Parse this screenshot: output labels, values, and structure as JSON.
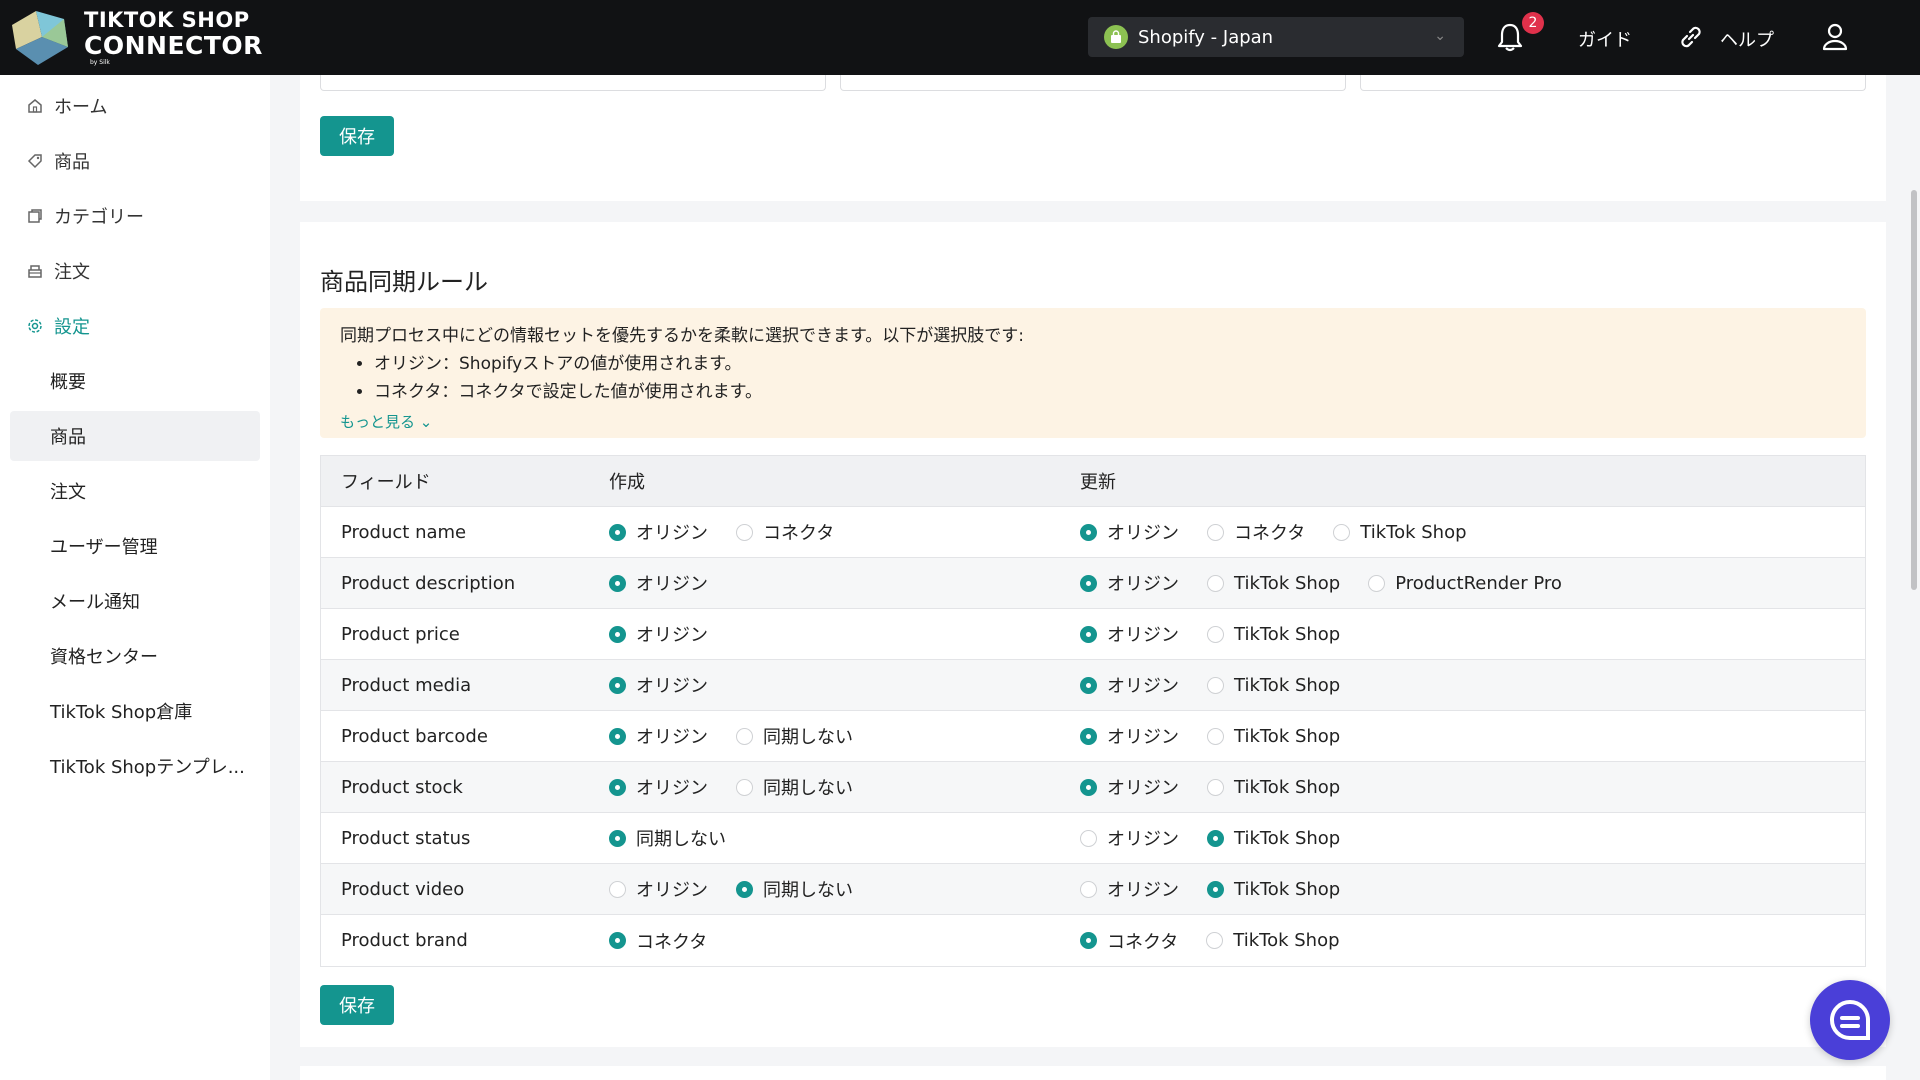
{
  "header": {
    "logo_line1": "TIKTOK SHOP",
    "logo_line2": "CONNECTOR",
    "logo_line3": "by Silk",
    "store_name": "Shopify - Japan",
    "notification_count": "2",
    "guide_label": "ガイド",
    "help_label": "ヘルプ"
  },
  "sidebar": {
    "items": [
      {
        "label": "ホーム",
        "icon": "home-icon"
      },
      {
        "label": "商品",
        "icon": "tag-icon"
      },
      {
        "label": "カテゴリー",
        "icon": "category-icon"
      },
      {
        "label": "注文",
        "icon": "order-icon"
      },
      {
        "label": "設定",
        "icon": "gear-icon"
      }
    ],
    "sub_items": [
      {
        "label": "概要"
      },
      {
        "label": "商品"
      },
      {
        "label": "注文"
      },
      {
        "label": "ユーザー管理"
      },
      {
        "label": "メール通知"
      },
      {
        "label": "資格センター"
      },
      {
        "label": "TikTok Shop倉庫"
      },
      {
        "label": "TikTok Shopテンプレ..."
      }
    ]
  },
  "top_card": {
    "save_label": "保存"
  },
  "sync_rules": {
    "title": "商品同期ルール",
    "notice_line1": "同期プロセス中にどの情報セットを優先するかを柔軟に選択できます。以下が選択肢です:",
    "notice_bullet1": "オリジン：Shopifyストアの値が使用されます。",
    "notice_bullet2": "コネクタ：コネクタで設定した値が使用されます。",
    "see_more": "もっと見る",
    "col_field": "フィールド",
    "col_create": "作成",
    "col_update": "更新",
    "rows": [
      {
        "field": "Product name",
        "create": [
          {
            "label": "オリジン",
            "on": true
          },
          {
            "label": "コネクタ",
            "on": false
          }
        ],
        "update": [
          {
            "label": "オリジン",
            "on": true
          },
          {
            "label": "コネクタ",
            "on": false
          },
          {
            "label": "TikTok Shop",
            "on": false
          }
        ]
      },
      {
        "field": "Product description",
        "create": [
          {
            "label": "オリジン",
            "on": true
          }
        ],
        "update": [
          {
            "label": "オリジン",
            "on": true
          },
          {
            "label": "TikTok Shop",
            "on": false
          },
          {
            "label": "ProductRender Pro",
            "on": false
          }
        ]
      },
      {
        "field": "Product price",
        "create": [
          {
            "label": "オリジン",
            "on": true
          }
        ],
        "update": [
          {
            "label": "オリジン",
            "on": true
          },
          {
            "label": "TikTok Shop",
            "on": false
          }
        ]
      },
      {
        "field": "Product media",
        "create": [
          {
            "label": "オリジン",
            "on": true
          }
        ],
        "update": [
          {
            "label": "オリジン",
            "on": true
          },
          {
            "label": "TikTok Shop",
            "on": false
          }
        ]
      },
      {
        "field": "Product barcode",
        "create": [
          {
            "label": "オリジン",
            "on": true
          },
          {
            "label": "同期しない",
            "on": false
          }
        ],
        "update": [
          {
            "label": "オリジン",
            "on": true
          },
          {
            "label": "TikTok Shop",
            "on": false
          }
        ]
      },
      {
        "field": "Product stock",
        "create": [
          {
            "label": "オリジン",
            "on": true
          },
          {
            "label": "同期しない",
            "on": false
          }
        ],
        "update": [
          {
            "label": "オリジン",
            "on": true
          },
          {
            "label": "TikTok Shop",
            "on": false
          }
        ]
      },
      {
        "field": "Product status",
        "create": [
          {
            "label": "同期しない",
            "on": true
          }
        ],
        "update": [
          {
            "label": "オリジン",
            "on": false
          },
          {
            "label": "TikTok Shop",
            "on": true
          }
        ]
      },
      {
        "field": "Product video",
        "create": [
          {
            "label": "オリジン",
            "on": false
          },
          {
            "label": "同期しない",
            "on": true
          }
        ],
        "update": [
          {
            "label": "オリジン",
            "on": false
          },
          {
            "label": "TikTok Shop",
            "on": true
          }
        ]
      },
      {
        "field": "Product brand",
        "create": [
          {
            "label": "コネクタ",
            "on": true
          }
        ],
        "update": [
          {
            "label": "コネクタ",
            "on": true
          },
          {
            "label": "TikTok Shop",
            "on": false
          }
        ]
      }
    ],
    "save_label": "保存"
  },
  "colors": {
    "accent": "#14958f",
    "topbar": "#111214",
    "notice_bg": "#fdf3e4",
    "chat": "#4a3fd8"
  }
}
